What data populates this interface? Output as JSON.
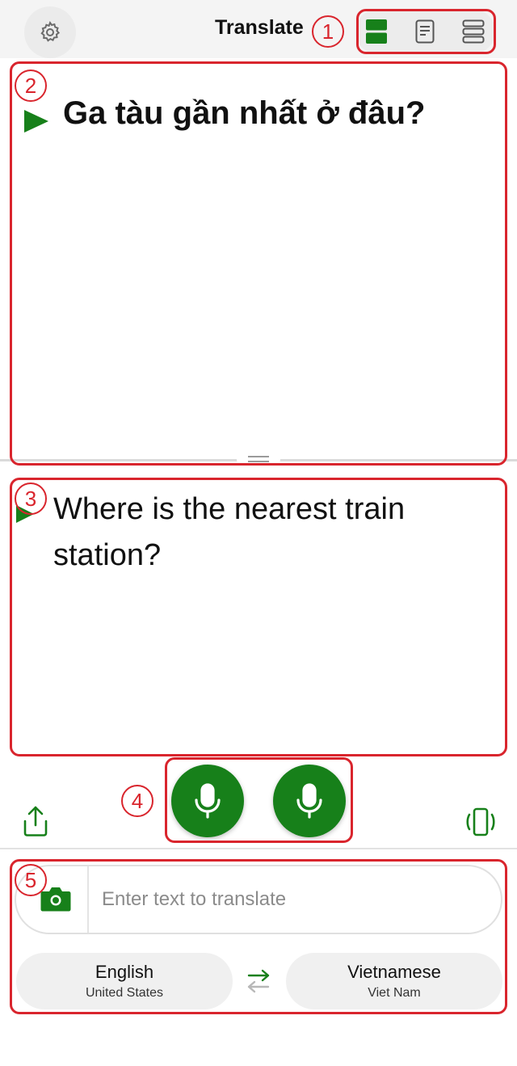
{
  "header": {
    "title": "Translate",
    "icons": [
      "gear-icon",
      "split-view-icon",
      "document-view-icon",
      "list-view-icon"
    ]
  },
  "source": {
    "text": "Ga tàu gần nhất ở đâu?",
    "icon": "play-icon"
  },
  "translation": {
    "text": "Where is the nearest train station?",
    "icon": "play-icon"
  },
  "controls": {
    "icons": [
      "share-icon",
      "microphone-icon",
      "microphone-icon",
      "vibrate-phone-icon"
    ]
  },
  "input": {
    "placeholder": "Enter text to translate",
    "icon": "camera-icon"
  },
  "languages": {
    "source": {
      "name": "English",
      "region": "United States"
    },
    "target": {
      "name": "Vietnamese",
      "region": "Viet Nam"
    },
    "swap_icon": "swap-arrows-icon"
  },
  "annotations": [
    "1",
    "2",
    "3",
    "4",
    "5"
  ],
  "colors": {
    "accent": "#17801a",
    "annotation": "#d9252d",
    "header_bg": "#f4f4f4"
  }
}
